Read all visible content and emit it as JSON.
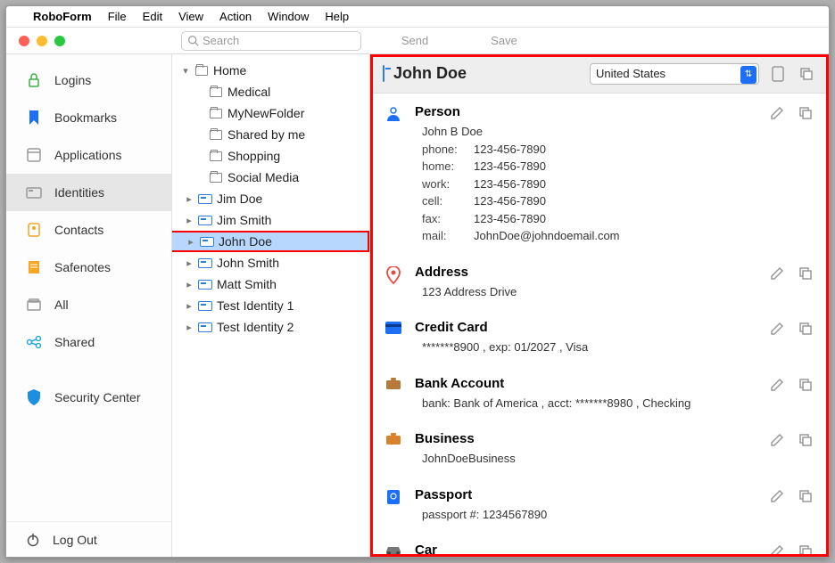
{
  "menubar": {
    "appname": "RoboForm",
    "items": [
      "File",
      "Edit",
      "View",
      "Action",
      "Window",
      "Help"
    ]
  },
  "toolbar": {
    "search_placeholder": "Search",
    "send": "Send",
    "save": "Save"
  },
  "sidebar": {
    "items": [
      {
        "label": "Logins",
        "icon": "lock",
        "color": "#3cb043"
      },
      {
        "label": "Bookmarks",
        "icon": "bookmark",
        "color": "#1d6ff7"
      },
      {
        "label": "Applications",
        "icon": "app",
        "color": "#999"
      },
      {
        "label": "Identities",
        "icon": "identity",
        "color": "#999",
        "selected": true
      },
      {
        "label": "Contacts",
        "icon": "contact",
        "color": "#f5a623"
      },
      {
        "label": "Safenotes",
        "icon": "note",
        "color": "#f5a623"
      },
      {
        "label": "All",
        "icon": "all",
        "color": "#999"
      },
      {
        "label": "Shared",
        "icon": "shared",
        "color": "#2aa7d9"
      }
    ],
    "security": "Security Center",
    "logout": "Log Out"
  },
  "tree": {
    "root": "Home",
    "folders": [
      "Medical",
      "MyNewFolder",
      "Shared by me",
      "Shopping",
      "Social Media"
    ],
    "identities": [
      "Jim Doe",
      "Jim Smith",
      "John Doe",
      "John Smith",
      "Matt Smith",
      "Test Identity 1",
      "Test Identity 2"
    ],
    "selected": "John Doe"
  },
  "detail": {
    "title": "John Doe",
    "country": "United States",
    "sections": {
      "person": {
        "title": "Person",
        "name": "John B Doe",
        "fields": [
          {
            "k": "phone:",
            "v": "123-456-7890"
          },
          {
            "k": "home:",
            "v": "123-456-7890"
          },
          {
            "k": "work:",
            "v": "123-456-7890"
          },
          {
            "k": "cell:",
            "v": "123-456-7890"
          },
          {
            "k": "fax:",
            "v": "123-456-7890"
          },
          {
            "k": "mail:",
            "v": "JohnDoe@johndoemail.com"
          }
        ]
      },
      "address": {
        "title": "Address",
        "line": "123 Address Drive"
      },
      "credit": {
        "title": "Credit Card",
        "line": "*******8900   ,   exp:   01/2027   ,   Visa"
      },
      "bank": {
        "title": "Bank Account",
        "line": "bank:   Bank of America   ,   acct:   *******8980   ,   Checking"
      },
      "business": {
        "title": "Business",
        "line": "JohnDoeBusiness"
      },
      "passport": {
        "title": "Passport",
        "line": "passport #:   1234567890"
      },
      "car": {
        "title": "Car"
      }
    }
  }
}
